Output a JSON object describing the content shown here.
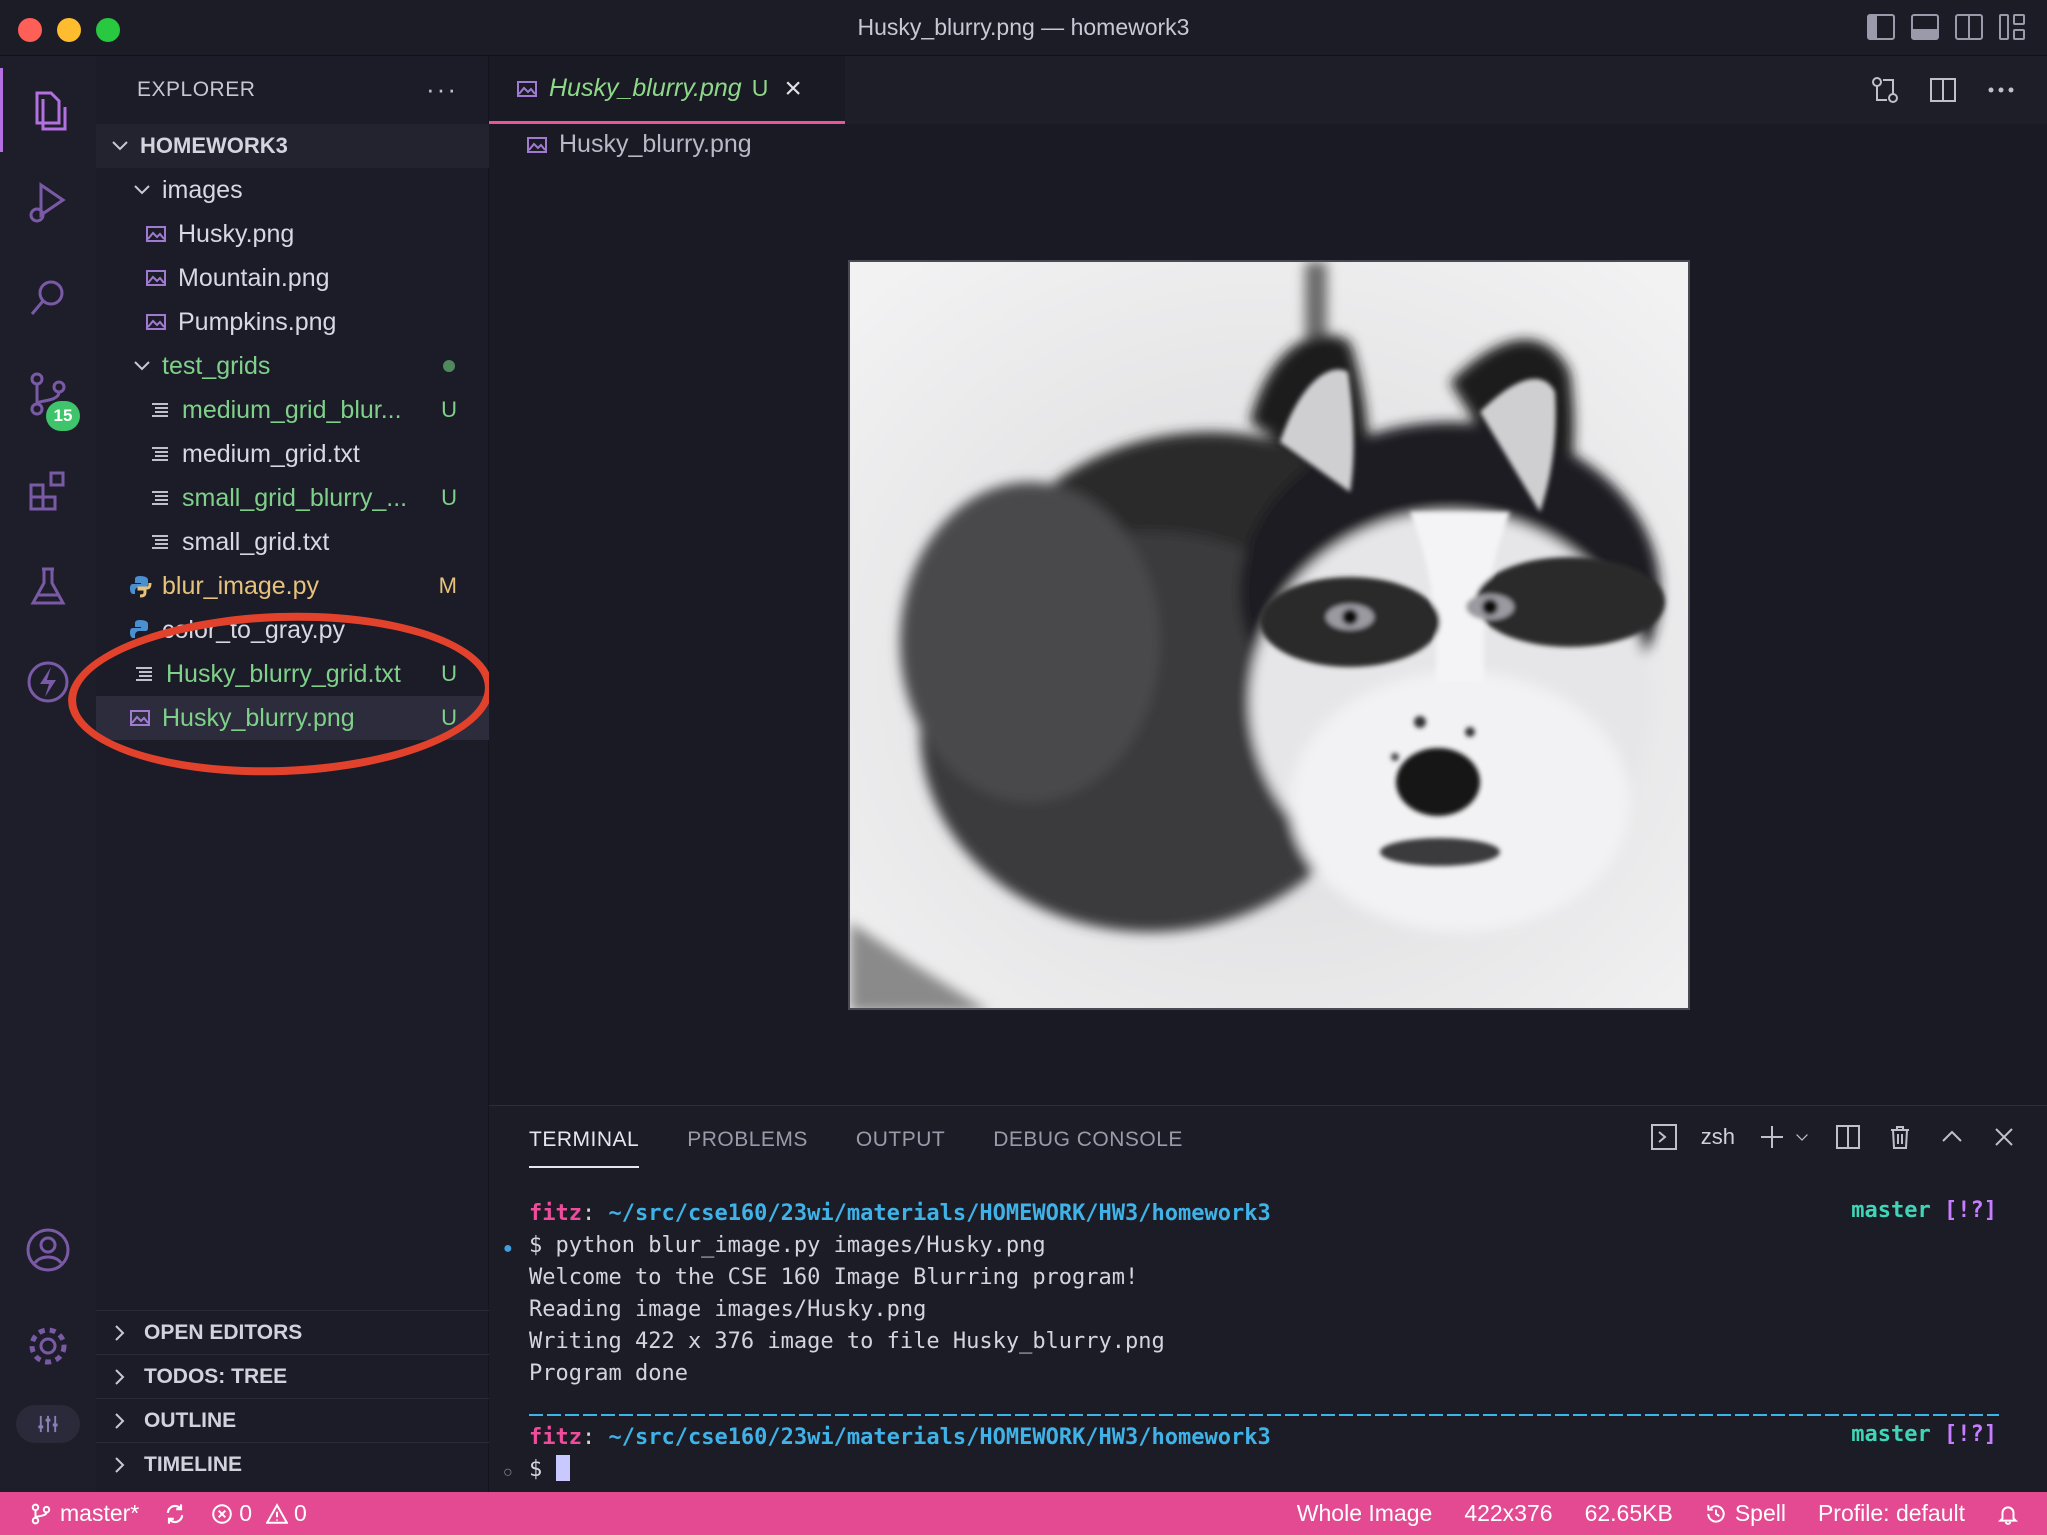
{
  "window": {
    "title": "Husky_blurry.png — homework3"
  },
  "sidebar": {
    "header": "EXPLORER",
    "more_label": "···",
    "root": "HOMEWORK3",
    "items": [
      {
        "label": "images",
        "kind": "folder"
      },
      {
        "label": "Husky.png",
        "kind": "image"
      },
      {
        "label": "Mountain.png",
        "kind": "image"
      },
      {
        "label": "Pumpkins.png",
        "kind": "image"
      },
      {
        "label": "test_grids",
        "kind": "folder"
      },
      {
        "label": "medium_grid_blur...",
        "kind": "text",
        "status": "U"
      },
      {
        "label": "medium_grid.txt",
        "kind": "text"
      },
      {
        "label": "small_grid_blurry_...",
        "kind": "text",
        "status": "U"
      },
      {
        "label": "small_grid.txt",
        "kind": "text"
      },
      {
        "label": "blur_image.py",
        "kind": "python",
        "status": "M"
      },
      {
        "label": "color_to_gray.py",
        "kind": "python"
      },
      {
        "label": "Husky_blurry_grid.txt",
        "kind": "text",
        "status": "U"
      },
      {
        "label": "Husky_blurry.png",
        "kind": "image",
        "status": "U"
      }
    ],
    "sections": [
      "OPEN EDITORS",
      "TODOS: TREE",
      "OUTLINE",
      "TIMELINE"
    ]
  },
  "activity": {
    "source_control_badge": "15"
  },
  "editor": {
    "tab_label": "Husky_blurry.png",
    "tab_status": "U",
    "breadcrumb": "Husky_blurry.png"
  },
  "panel": {
    "tabs": [
      "TERMINAL",
      "PROBLEMS",
      "OUTPUT",
      "DEBUG CONSOLE"
    ],
    "shell": "zsh",
    "prompt_user": "fitz",
    "prompt_path": "~/src/cse160/23wi/materials/HOMEWORK/HW3/homework3",
    "branch": "master",
    "branch_flags": "[!?]",
    "command": "$ python blur_image.py images/Husky.png",
    "output": [
      "Welcome to the CSE 160 Image Blurring program!",
      "Reading image images/Husky.png",
      "Writing 422 x 376 image to file Husky_blurry.png",
      "Program done"
    ],
    "second_prompt": "$"
  },
  "statusbar": {
    "branch": "master*",
    "errors": "0",
    "warnings": "0",
    "zoom": "Whole Image",
    "dimensions": "422x376",
    "size": "62.65KB",
    "spell": "Spell",
    "profile": "Profile: default"
  },
  "colors": {
    "accent": "#e34a92",
    "untracked": "#7fd18a",
    "modified": "#e6c27a",
    "annotation": "#e2422c"
  }
}
